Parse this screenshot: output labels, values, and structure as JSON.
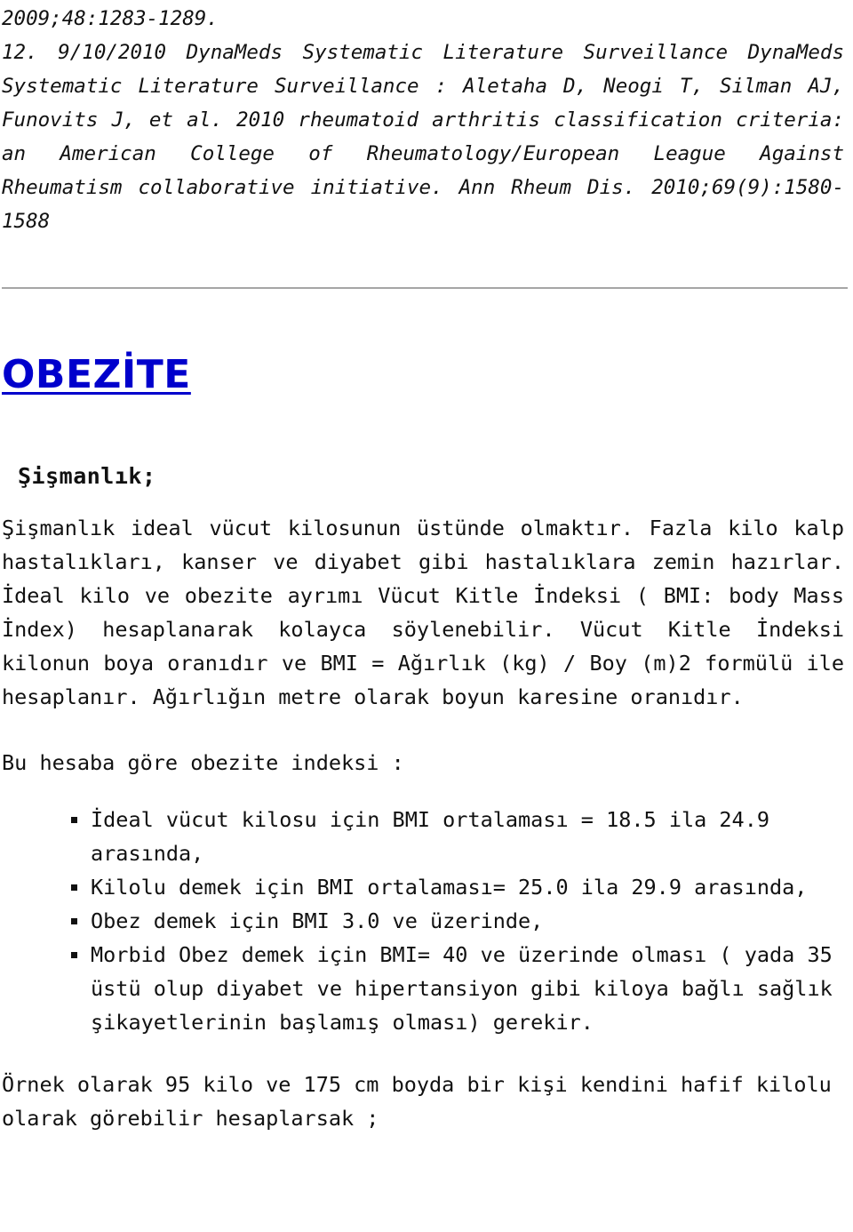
{
  "document": {
    "language": "tr",
    "background_color": "#ffffff",
    "text_color": "#111111",
    "heading_color": "#0000cc",
    "divider_color": "#a6a6a6"
  },
  "references": {
    "tail_of_previous": "2009;48:1283-1289.",
    "entry": "12. 9/10/2010 DynaMeds Systematic Literature Surveillance DynaMeds Systematic Literature Surveillance : Aletaha D, Neogi T, Silman AJ, Funovits J, et al. 2010 rheumatoid arthritis classification criteria: an American College of Rheumatology/European League Against Rheumatism collaborative initiative. Ann Rheum Dis. 2010;69(9):1580-1588"
  },
  "section": {
    "heading": "OBEZİTE",
    "sub_heading": "Şişmanlık;",
    "paragraph_1": "Şişmanlık ideal vücut kilosunun üstünde olmaktır. Fazla kilo kalp hastalıkları, kanser ve diyabet gibi hastalıklara zemin hazırlar. İdeal kilo ve obezite ayrımı Vücut Kitle İndeksi ( BMI: body Mass İndex) hesaplanarak kolayca söylenebilir. Vücut Kitle İndeksi kilonun boya oranıdır ve BMI = Ağırlık (kg) / Boy (m)2 formülü ile hesaplanır. Ağırlığın metre olarak boyun karesine oranıdır.",
    "list_lead_in": "Bu hesaba göre obezite indeksi :",
    "bullets": [
      "İdeal vücut kilosu için BMI ortalaması = 18.5 ila 24.9 arasında,",
      "Kilolu demek için BMI ortalaması= 25.0 ila 29.9 arasında,",
      "Obez demek için BMI 3.0 ve üzerinde,",
      "Morbid Obez demek için BMI= 40 ve üzerinde olması ( yada 35 üstü olup diyabet ve hipertansiyon gibi kiloya bağlı sağlık şikayetlerinin başlamış olması) gerekir."
    ],
    "paragraph_2": "Örnek olarak 95 kilo ve 175 cm boyda bir kişi kendini hafif kilolu olarak görebilir hesaplarsak ;"
  }
}
